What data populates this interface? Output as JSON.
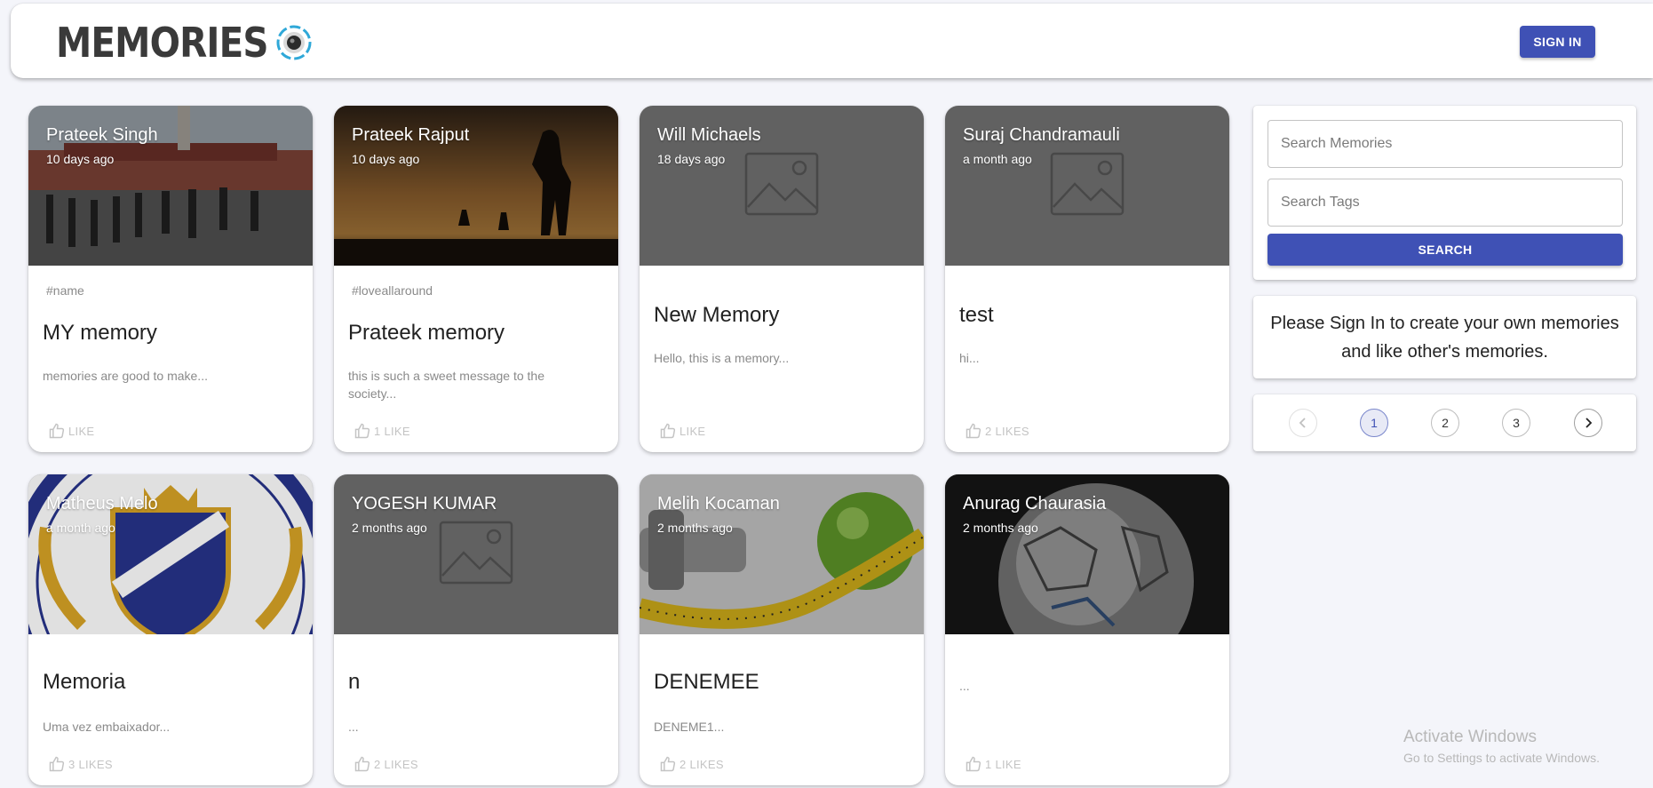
{
  "header": {
    "brand": "MEMORIES",
    "sign_in_label": "SIGN IN"
  },
  "cards": [
    {
      "author": "Prateek Singh",
      "time": "10 days ago",
      "tags": "#name",
      "title": "MY memory",
      "message": "memories are good to make...",
      "like": "LIKE",
      "image": "photo-parade"
    },
    {
      "author": "Prateek Rajput",
      "time": "10 days ago",
      "tags": "#loveallaround",
      "title": "Prateek memory",
      "message": "this is such a sweet message to the society...",
      "like": "1 LIKE",
      "image": "photo-soldier-silhouette"
    },
    {
      "author": "Will Michaels",
      "time": "18 days ago",
      "tags": "",
      "title": "New Memory",
      "message": "Hello, this is a memory...",
      "like": "LIKE",
      "image": "image-placeholder"
    },
    {
      "author": "Suraj Chandramauli",
      "time": "a month ago",
      "tags": "",
      "title": "test",
      "message": "hi...",
      "like": "2 LIKES",
      "image": "image-placeholder"
    },
    {
      "author": "Matheus Melo",
      "time": "a month ago",
      "tags": "",
      "title": "Memoria",
      "message": "Uma vez embaixador...",
      "like": "3 LIKES",
      "image": "photo-crest"
    },
    {
      "author": "YOGESH KUMAR",
      "time": "2 months ago",
      "tags": "",
      "title": "n",
      "message": "...",
      "like": "2 LIKES",
      "image": "image-placeholder"
    },
    {
      "author": "Melih Kocaman",
      "time": "2 months ago",
      "tags": "",
      "title": "DENEMEE",
      "message": "DENEME1...",
      "like": "2 LIKES",
      "image": "photo-apple-tape"
    },
    {
      "author": "Anurag Chaurasia",
      "time": "2 months ago",
      "tags": "",
      "title": "",
      "message": "...",
      "like": "1 LIKE",
      "image": "photo-ball"
    }
  ],
  "search": {
    "memories_placeholder": "Search Memories",
    "tags_placeholder": "Search Tags",
    "button_label": "SEARCH"
  },
  "signin_message": "Please Sign In to create your own memories and like other's memories.",
  "pagination": {
    "pages": [
      "1",
      "2",
      "3"
    ],
    "current": "1"
  },
  "watermark": {
    "line1": "Activate Windows",
    "line2": "Go to Settings to activate Windows."
  },
  "colors": {
    "primary": "#3f51b5",
    "background": "#f4f5fa"
  }
}
